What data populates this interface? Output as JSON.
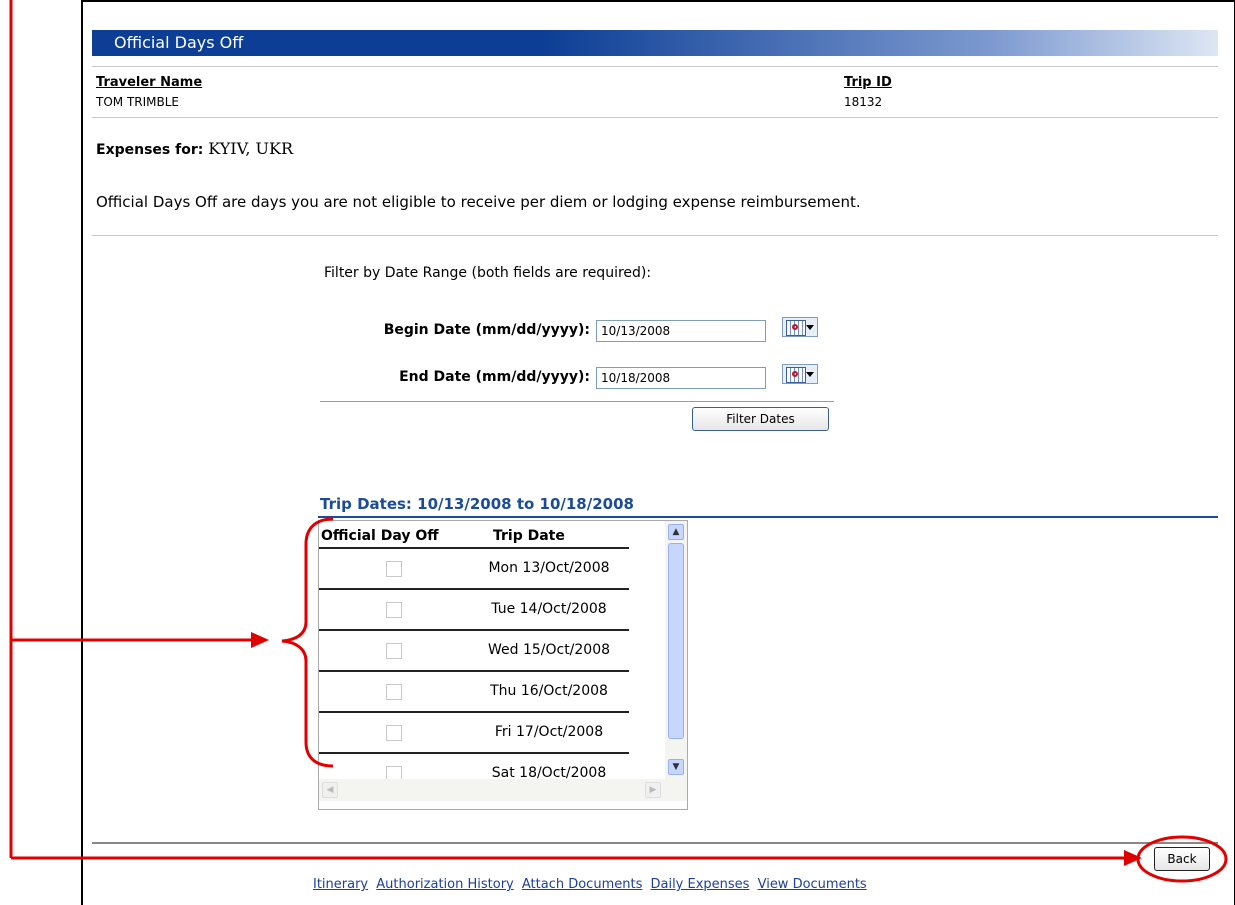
{
  "section_title": "Official Days Off",
  "traveler": {
    "label": "Traveler Name",
    "value": "TOM TRIMBLE"
  },
  "trip": {
    "label": "Trip ID",
    "value": "18132"
  },
  "expenses": {
    "label": "Expenses for:",
    "location": "KYIV, UKR"
  },
  "notice": "Official Days Off are days you are not eligible to receive per diem or lodging expense reimbursement.",
  "filter": {
    "title": "Filter by Date Range (both fields are required):",
    "begin_label": "Begin Date (mm/dd/yyyy):",
    "begin_value": "10/13/2008",
    "end_label": "End Date (mm/dd/yyyy):",
    "end_value": "10/18/2008",
    "button_label": "Filter Dates"
  },
  "trip_dates": {
    "title": "Trip Dates: 10/13/2008 to 10/18/2008",
    "col_official": "Official Day Off",
    "col_date": "Trip Date",
    "rows": [
      {
        "date": "Mon 13/Oct/2008",
        "checked": false
      },
      {
        "date": "Tue 14/Oct/2008",
        "checked": false
      },
      {
        "date": "Wed 15/Oct/2008",
        "checked": false
      },
      {
        "date": "Thu 16/Oct/2008",
        "checked": false
      },
      {
        "date": "Fri 17/Oct/2008",
        "checked": false
      },
      {
        "date": "Sat 18/Oct/2008",
        "checked": false
      }
    ]
  },
  "back_button": "Back",
  "footer_links": [
    "Itinerary",
    "Authorization History",
    "Attach Documents",
    "Daily Expenses",
    "View Documents"
  ],
  "colors": {
    "header_blue": "#0c3e95",
    "title_blue": "#1b4c9a",
    "annotation_red": "#e00000",
    "link_blue": "#1d3f9b"
  },
  "icons": {
    "calendar": "calendar-icon",
    "dropdown": "chevron-down-icon"
  }
}
